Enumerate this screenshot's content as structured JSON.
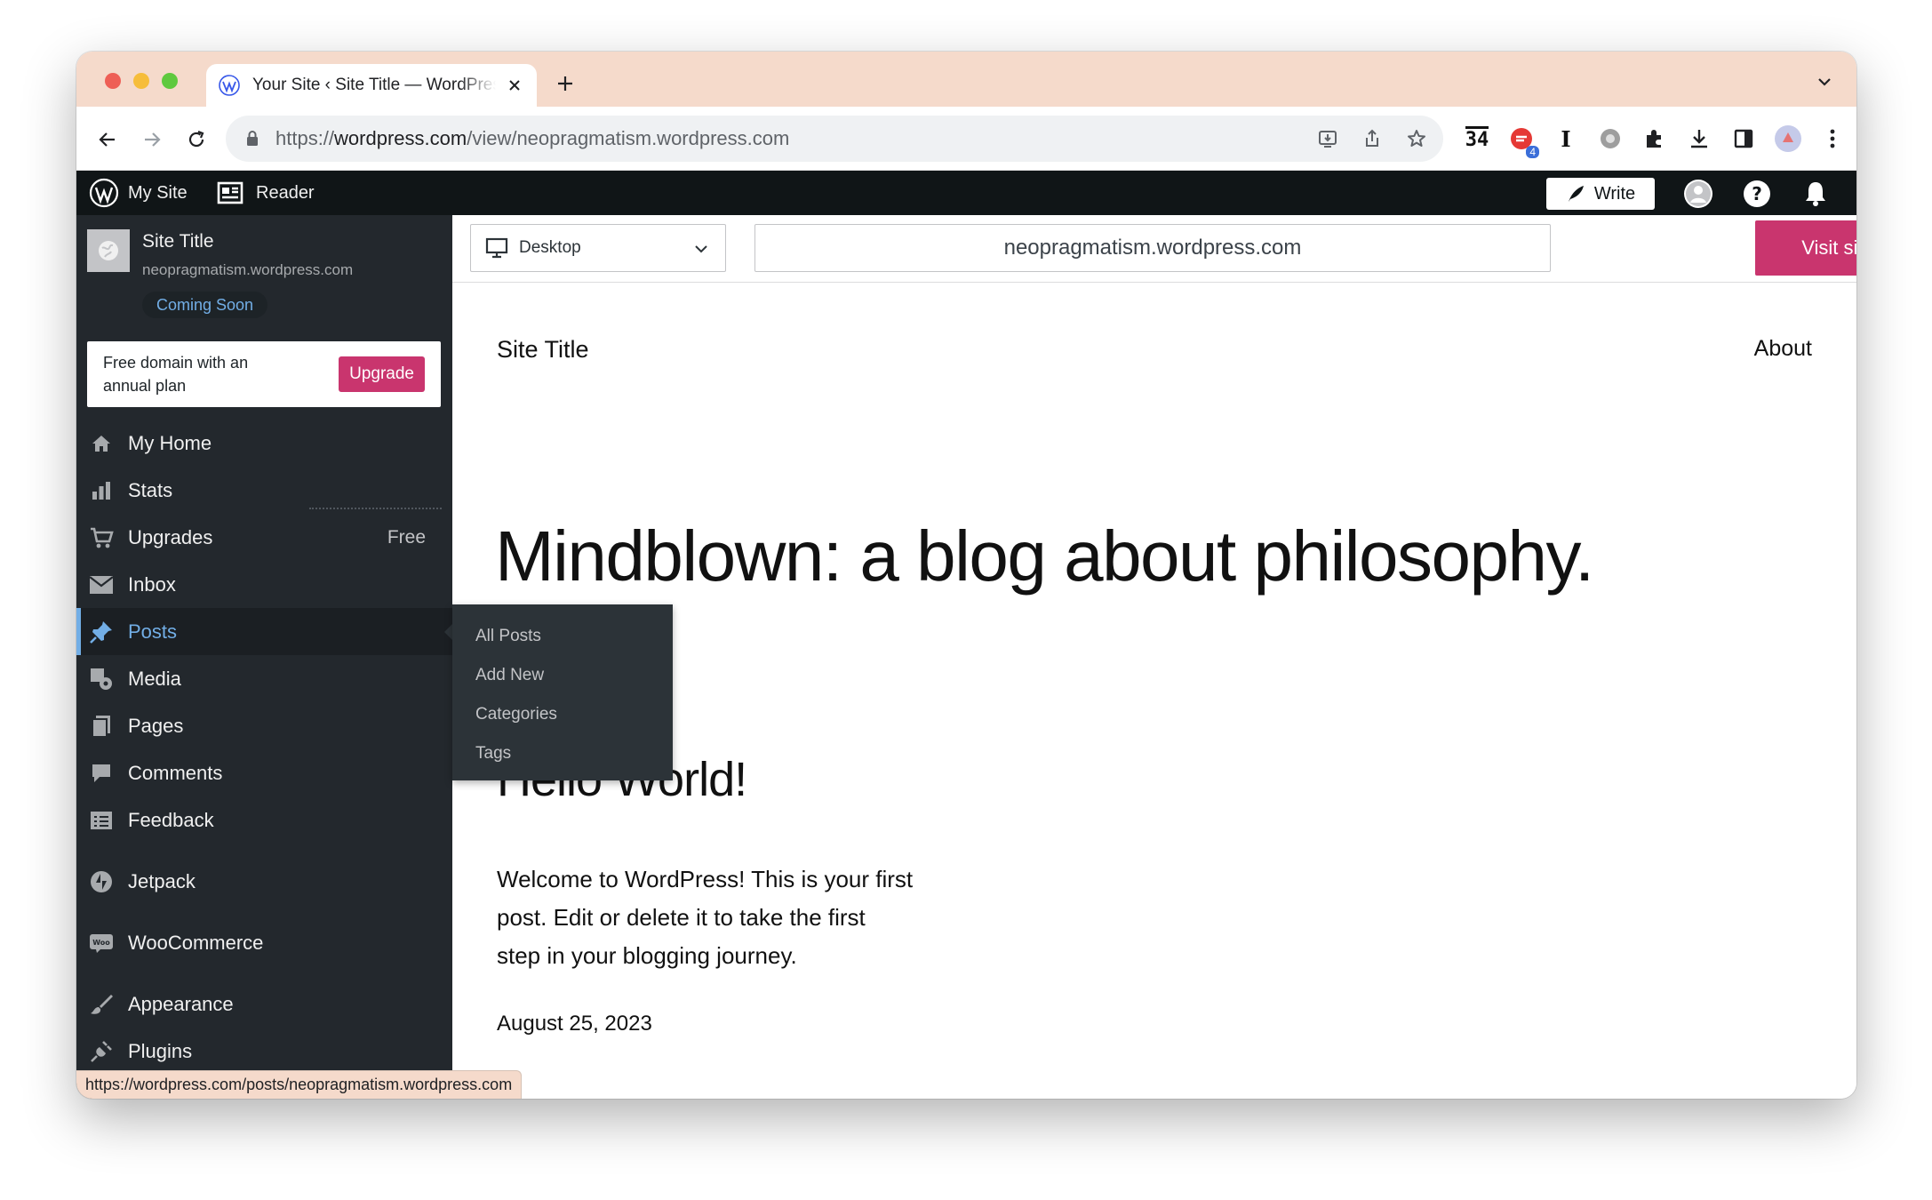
{
  "browser": {
    "tab_title": "Your Site ‹ Site Title — WordPress.com",
    "url_prefix": "https://",
    "url_domain": "wordpress.com",
    "url_path": "/view/neopragmatism.wordpress.com",
    "extension_badge": "4",
    "calendar_day": "34",
    "status_url": "https://wordpress.com/posts/neopragmatism.wordpress.com"
  },
  "adminbar": {
    "my_site": "My Site",
    "reader": "Reader",
    "write": "Write"
  },
  "sidebar": {
    "site_name": "Site Title",
    "site_url": "neopragmatism.wordpress.com",
    "status_badge": "Coming Soon",
    "upsell_text": "Free domain with an annual plan",
    "upgrade_label": "Upgrade",
    "items": [
      {
        "label": "My Home"
      },
      {
        "label": "Stats"
      },
      {
        "label": "Upgrades",
        "right": "Free"
      },
      {
        "label": "Inbox"
      },
      {
        "label": "Posts"
      },
      {
        "label": "Media"
      },
      {
        "label": "Pages"
      },
      {
        "label": "Comments"
      },
      {
        "label": "Feedback"
      },
      {
        "label": "Jetpack"
      },
      {
        "label": "WooCommerce"
      },
      {
        "label": "Appearance"
      },
      {
        "label": "Plugins"
      }
    ],
    "posts_flyout": [
      "All Posts",
      "Add New",
      "Categories",
      "Tags"
    ]
  },
  "preview": {
    "device": "Desktop",
    "url": "neopragmatism.wordpress.com",
    "visit_label": "Visit site",
    "site_title": "Site Title",
    "nav_about": "About",
    "hero": "Mindblown: a blog about philosophy.",
    "post_title": "Hello World!",
    "post_excerpt": "Welcome to WordPress! This is your first post. Edit or delete it to take the first step in your blogging journey.",
    "post_date": "August 25, 2023"
  },
  "colors": {
    "accent": "#c9356e",
    "sidebar_bg": "#23282d",
    "active_blue": "#72aee6",
    "tabstrip": "#f5dacb"
  }
}
